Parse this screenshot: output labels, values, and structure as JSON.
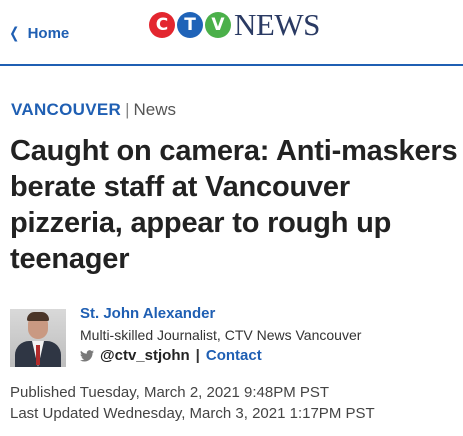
{
  "header": {
    "home_label": "Home",
    "logo": {
      "letters": [
        "C",
        "T",
        "V"
      ],
      "wordmark": "NEWS",
      "colors": [
        "#e3262f",
        "#1f63b8",
        "#4bb04a"
      ]
    }
  },
  "article": {
    "section": "VANCOUVER",
    "section_separator": "|",
    "type": "News",
    "headline": "Caught on camera: Anti-maskers berate staff at Vancouver pizzeria, appear to rough up teenager",
    "author": {
      "name": "St. John Alexander",
      "title": "Multi-skilled Journalist, CTV News Vancouver",
      "twitter_handle": "@ctv_stjohn",
      "separator": "|",
      "contact_label": "Contact"
    },
    "published": "Published Tuesday, March 2, 2021 9:48PM PST",
    "updated": "Last Updated Wednesday, March 3, 2021 1:17PM PST"
  },
  "colors": {
    "accent": "#1f5fb3",
    "text": "#222222"
  },
  "icons": {
    "home": "chevron-left-icon",
    "social": "twitter-bird-icon"
  }
}
